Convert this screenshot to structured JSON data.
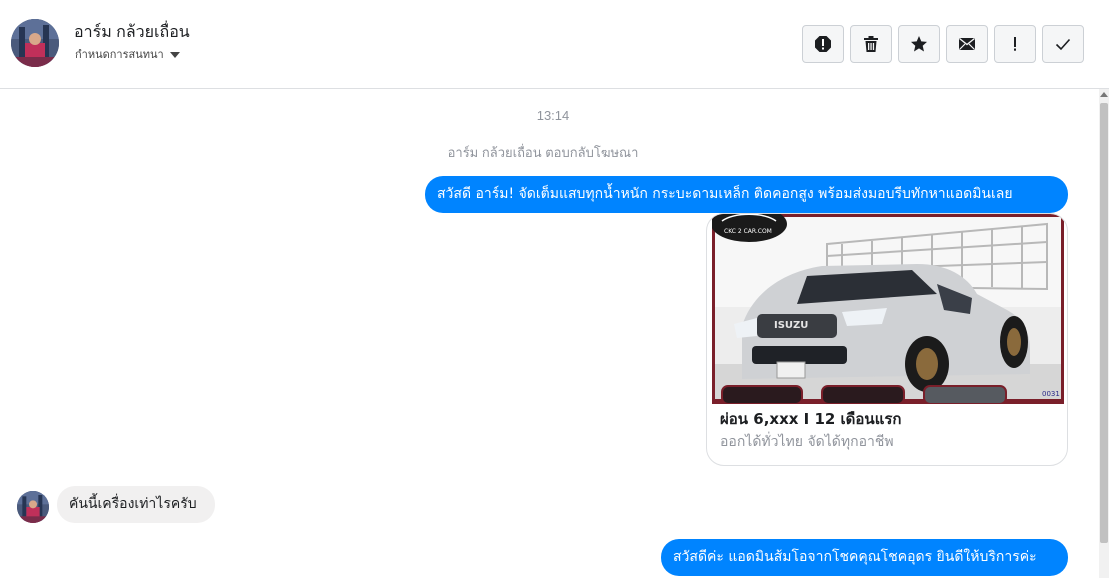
{
  "header": {
    "contact_name": "อาร์ม กล้วยเถื่อน",
    "assign_label": "กำหนดการสนทนา",
    "tools": [
      {
        "name": "report-icon"
      },
      {
        "name": "trash-icon"
      },
      {
        "name": "star-icon"
      },
      {
        "name": "envelope-icon"
      },
      {
        "name": "exclamation-icon"
      },
      {
        "name": "check-icon"
      }
    ]
  },
  "conversation": {
    "timestamp": "13:14",
    "system_note": "อาร์ม กล้วยเถื่อน ตอบกลับโฆษณา",
    "messages": [
      {
        "direction": "out",
        "text": "สวัสดี อาร์ม! จัดเต็มแสบทุกน้ำหนัก กระบะดามเหล็ก ติดคอกสูง พร้อมส่งมอบรีบทักหาแอดมินเลย"
      },
      {
        "direction": "in",
        "text": "คันนี้เครื่องเท่าไรครับ"
      },
      {
        "direction": "out",
        "text": "สวัสดีค่ะ แอดมินส้มโอจากโชคคุณโชคอุดร ยินดีให้บริการค่ะ"
      }
    ],
    "ad_card": {
      "title": "ผ่อน 6,xxx I 12 เดือนแรก",
      "subtitle": "ออกได้ทั่วไทย จัดได้ทุกอาชีพ",
      "logo_text": "CKC 2 CAR.COM",
      "grille_text": "ISUZU",
      "corner_code": "0031"
    }
  },
  "colors": {
    "accent": "#0084ff",
    "incoming_bubble": "#f1f0f0",
    "muted_text": "#90949c"
  }
}
